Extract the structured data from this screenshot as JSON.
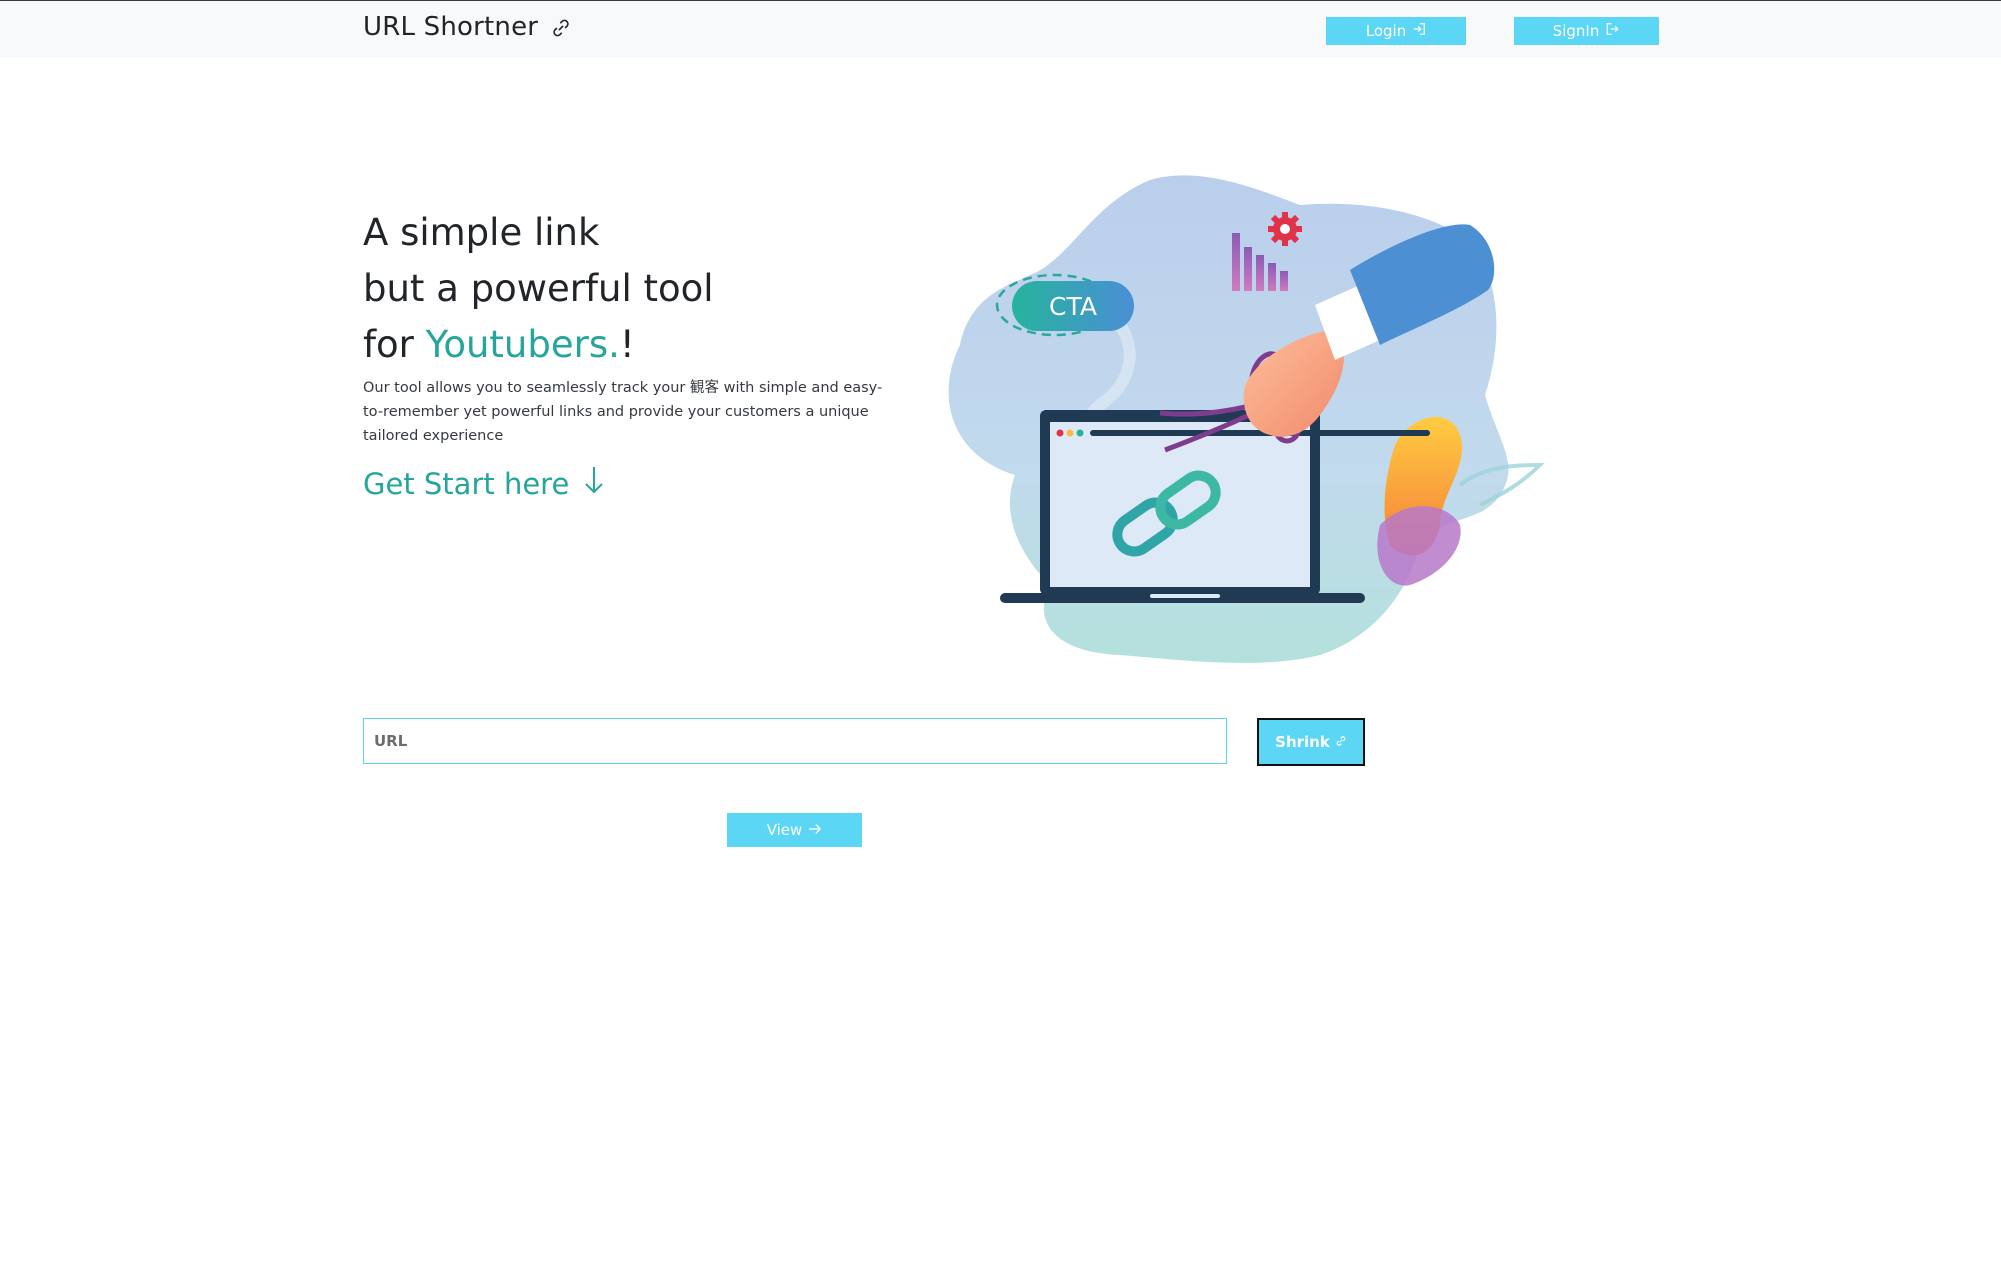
{
  "navbar": {
    "brand": "URL Shortner",
    "brand_icon": "link-icon",
    "login_label": "Login",
    "login_icon": "login-icon",
    "signin_label": "SignIn",
    "signin_icon": "signin-icon"
  },
  "hero": {
    "line1": "A simple link",
    "line2": "but a powerful tool",
    "line3_prefix": "for ",
    "line3_accent": "Youtubers.",
    "line3_suffix": "!",
    "description": "Our tool allows you to seamlessly track your 観客 with simple and easy-to-remember yet powerful links and provide your customers a unique tailored experience",
    "cta": "Get Start here",
    "cta_icon": "arrow-down-icon"
  },
  "illustration": {
    "badge": "CTA"
  },
  "form": {
    "url_placeholder": "URL",
    "shrink_label": "Shrink",
    "shrink_icon": "link-icon",
    "view_label": "View",
    "view_icon": "arrow-right-icon"
  },
  "colors": {
    "accent": "#26a69a",
    "button": "#5bd6f4",
    "navbar_bg": "#f8f9fa"
  }
}
